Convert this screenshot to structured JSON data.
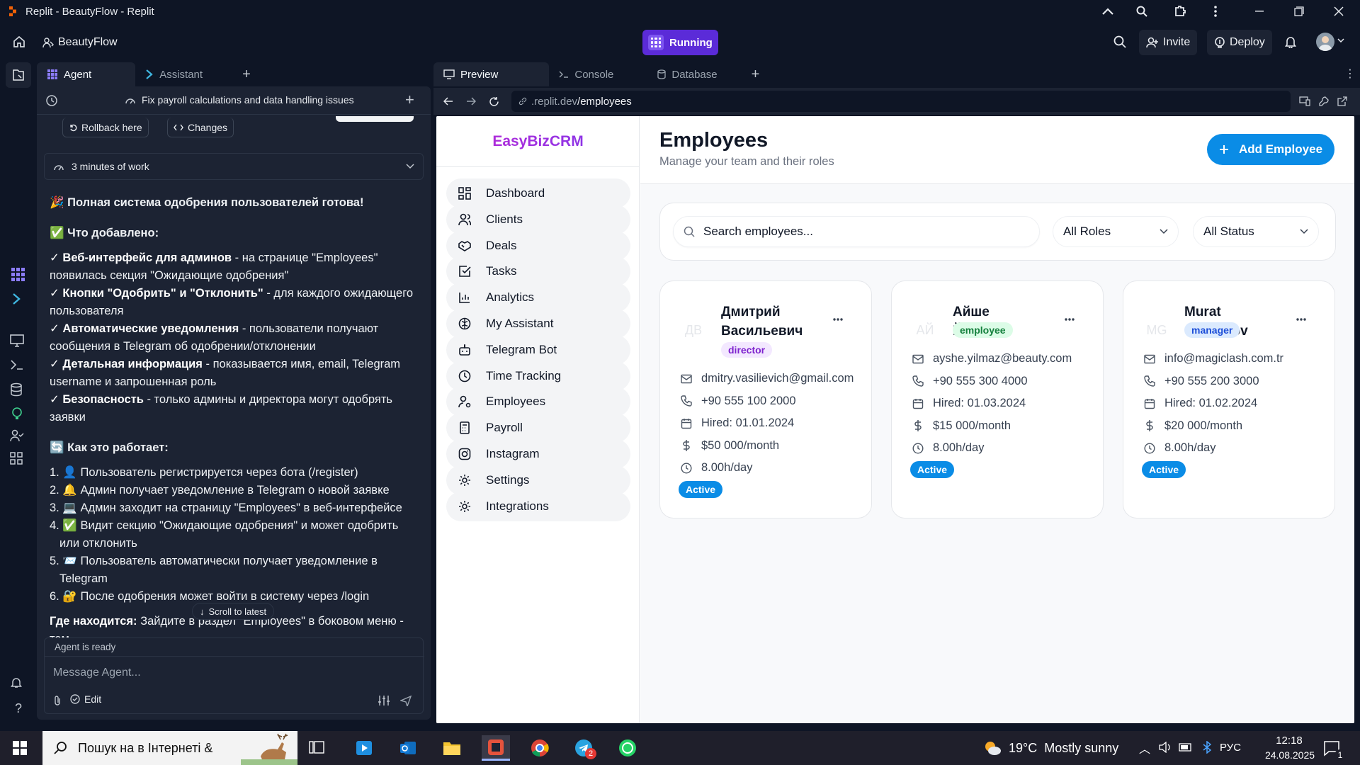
{
  "window": {
    "title": "Replit - BeautyFlow - Replit"
  },
  "topbar": {
    "project_name": "BeautyFlow",
    "running_label": "Running",
    "invite_label": "Invite",
    "deploy_label": "Deploy"
  },
  "agent_tabs": {
    "agent": "Agent",
    "assistant": "Assistant"
  },
  "agent": {
    "thread_title": "Fix payroll calculations and data handling issues",
    "rollback_label": "Rollback here",
    "changes_label": "Changes",
    "work_time": "3 minutes of work",
    "msg_title": "🎉 Полная система одобрения пользователей готова!",
    "added_title": "✅ Что добавлено:",
    "features": [
      {
        "bold": "✓ Веб-интерфейс для админов",
        "text": " - на странице \"Employees\" появилась секция \"Ожидающие одобрения\""
      },
      {
        "bold": "✓ Кнопки \"Одобрить\" и \"Отклонить\"",
        "text": " - для каждого ожидающего пользователя"
      },
      {
        "bold": "✓ Автоматические уведомления",
        "text": " - пользователи получают сообщения в Telegram об одобрении/отклонении"
      },
      {
        "bold": "✓ Детальная информация",
        "text": " - показывается имя, email, Telegram username и запрошенная роль"
      },
      {
        "bold": "✓ Безопасность",
        "text": " - только админы и директора могут одобрять заявки"
      }
    ],
    "how_title": "🔄 Как это работает:",
    "steps": [
      "1. 👤 Пользователь регистрируется через бота (/register)",
      "2. 🔔 Админ получает уведомление в Telegram о новой заявке",
      "3. 💻 Админ заходит на страницу \"Employees\" в веб-интерфейсе",
      "4. ✅ Видит секцию \"Ожидающие одобрения\" и может одобрить или отклонить",
      "5. 📨 Пользователь автоматически получает уведомление в Telegram",
      "6. 🔐 После одобрения может войти в систему через /login"
    ],
    "where_bold": "Где находится:",
    "where_text": " Зайдите в раздел \"Employees\" в боковом меню - там",
    "scroll_latest": "Scroll to latest",
    "status": "Agent is ready",
    "message_placeholder": "Message Agent...",
    "edit_label": "Edit"
  },
  "preview_tabs": {
    "preview": "Preview",
    "console": "Console",
    "database": "Database"
  },
  "url": {
    "domain": ".replit.dev",
    "path": "/employees"
  },
  "crm": {
    "logo": "EasyBizCRM",
    "nav": [
      {
        "label": "Dashboard",
        "icon": "dashboard-icon"
      },
      {
        "label": "Clients",
        "icon": "users-icon"
      },
      {
        "label": "Deals",
        "icon": "handshake-icon"
      },
      {
        "label": "Tasks",
        "icon": "checkbox-icon"
      },
      {
        "label": "Analytics",
        "icon": "bar-chart-icon"
      },
      {
        "label": "My Assistant",
        "icon": "brain-icon"
      },
      {
        "label": "Telegram Bot",
        "icon": "bot-icon"
      },
      {
        "label": "Time Tracking",
        "icon": "clock-icon"
      },
      {
        "label": "Employees",
        "icon": "user-cog-icon"
      },
      {
        "label": "Payroll",
        "icon": "calculator-icon"
      },
      {
        "label": "Instagram",
        "icon": "instagram-icon"
      },
      {
        "label": "Settings",
        "icon": "gear-icon"
      },
      {
        "label": "Integrations",
        "icon": "gear-icon"
      }
    ],
    "title": "Employees",
    "subtitle": "Manage your team and their roles",
    "add_button": "Add Employee",
    "search_placeholder": "Search employees...",
    "role_filter": "All Roles",
    "status_filter": "All Status",
    "employees": [
      {
        "initials": "ДВ",
        "name": "Дмитрий Васильевич",
        "role": "director",
        "role_bg": "#f3e8ff",
        "role_color": "#7e22ce",
        "email": "dmitry.vasilievich@gmail.com",
        "phone": "+90 555 100 2000",
        "hired": "Hired: 01.01.2024",
        "salary": "$50 000/month",
        "hours": "8.00h/day",
        "status": "Active"
      },
      {
        "initials": "АЙ",
        "name": "Айше Йылмаз",
        "role": "employee",
        "role_bg": "#dcfce7",
        "role_color": "#15803d",
        "email": "ayshe.yilmaz@beauty.com",
        "phone": "+90 555 300 4000",
        "hired": "Hired: 01.03.2024",
        "salary": "$15 000/month",
        "hours": "8.00h/day",
        "status": "Active"
      },
      {
        "initials": "MG",
        "name": "Murat Gurbanov",
        "role": "manager",
        "role_bg": "#dbeafe",
        "role_color": "#1d4ed8",
        "email": "info@magiclash.com.tr",
        "phone": "+90 555 200 3000",
        "hired": "Hired: 01.02.2024",
        "salary": "$20 000/month",
        "hours": "8.00h/day",
        "status": "Active"
      }
    ]
  },
  "taskbar": {
    "search_text": "Пошук на в Інтернеті &",
    "weather": "19°C  Mostly sunny",
    "lang": "РУС",
    "time": "12:18",
    "date": "24.08.2025",
    "notif_count": "1",
    "telegram_badge": "2"
  }
}
